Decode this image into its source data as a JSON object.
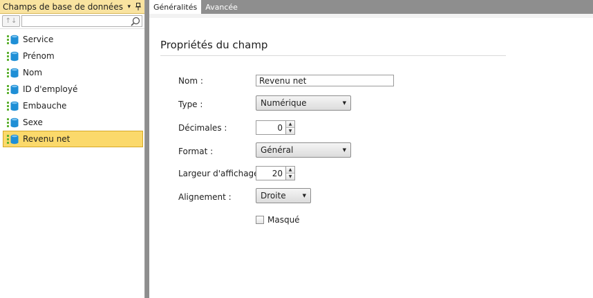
{
  "left_panel": {
    "title": "Champs de base de données",
    "dropdown_glyph": "▾",
    "pin_glyph": "ꟸ",
    "sort_glyph": "↑↓",
    "search": {
      "value": "",
      "placeholder": ""
    },
    "fields": [
      {
        "label": "Service",
        "selected": false
      },
      {
        "label": "Prénom",
        "selected": false
      },
      {
        "label": "Nom",
        "selected": false
      },
      {
        "label": "ID d'employé",
        "selected": false
      },
      {
        "label": "Embauche",
        "selected": false
      },
      {
        "label": "Sexe",
        "selected": false
      },
      {
        "label": "Revenu net",
        "selected": true
      }
    ]
  },
  "tabs": [
    {
      "label": "Généralités",
      "active": true
    },
    {
      "label": "Avancée",
      "active": false
    }
  ],
  "properties": {
    "title": "Propriétés du champ",
    "name_label": "Nom :",
    "name_value": "Revenu net",
    "type_label": "Type :",
    "type_value": "Numérique",
    "decimals_label": "Décimales :",
    "decimals_value": "0",
    "format_label": "Format :",
    "format_value": "Général",
    "width_label": "Largeur d'affichage :",
    "width_value": "20",
    "align_label": "Alignement :",
    "align_value": "Droite",
    "hidden_label": "Masqué",
    "hidden_checked": false
  },
  "colors": {
    "header_bg": "#f9e3a0",
    "selected_bg": "#fbd96b",
    "tabstrip_bg": "#8e8e8e",
    "db_icon_blue": "#1f8fd6",
    "db_icon_green": "#5fb233"
  }
}
